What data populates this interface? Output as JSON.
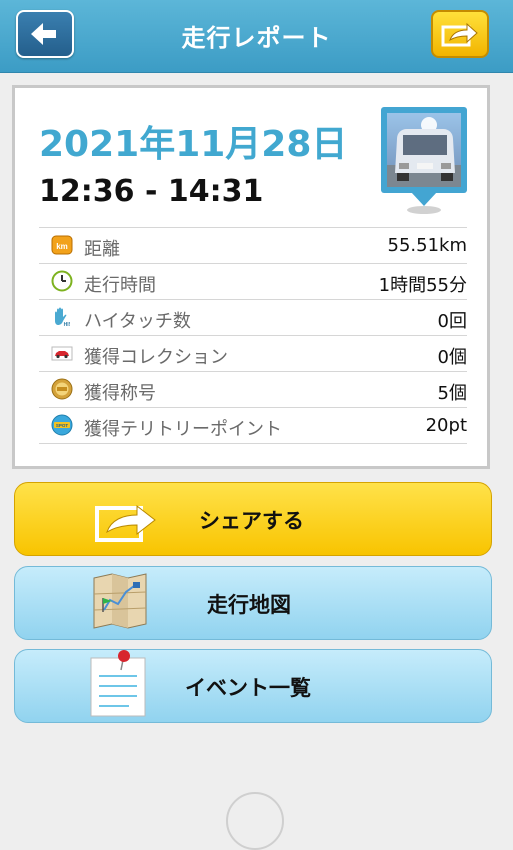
{
  "header": {
    "title": "走行レポート"
  },
  "report": {
    "date": "2021年11月28日",
    "time_range": "12:36 - 14:31"
  },
  "stats": [
    {
      "icon": "km-icon",
      "label": "距離",
      "value": "55.51km"
    },
    {
      "icon": "clock-icon",
      "label": "走行時間",
      "value": "1時間55分"
    },
    {
      "icon": "hand-icon",
      "label": "ハイタッチ数",
      "value": "0回"
    },
    {
      "icon": "car-icon",
      "label": "獲得コレクション",
      "value": "0個"
    },
    {
      "icon": "medal-icon",
      "label": "獲得称号",
      "value": "5個"
    },
    {
      "icon": "spot-icon",
      "label": "獲得テリトリーポイント",
      "value": "20pt"
    }
  ],
  "icon_text": {
    "km": "km",
    "hand": "HI!",
    "spot": "SPOT"
  },
  "buttons": {
    "share": "シェアする",
    "map": "走行地図",
    "events": "イベント一覧"
  },
  "colors": {
    "header": "#4aa9d1",
    "date_text": "#41a8d0",
    "share_button": "#f8c400",
    "menu_button": "#a6dcf3"
  }
}
